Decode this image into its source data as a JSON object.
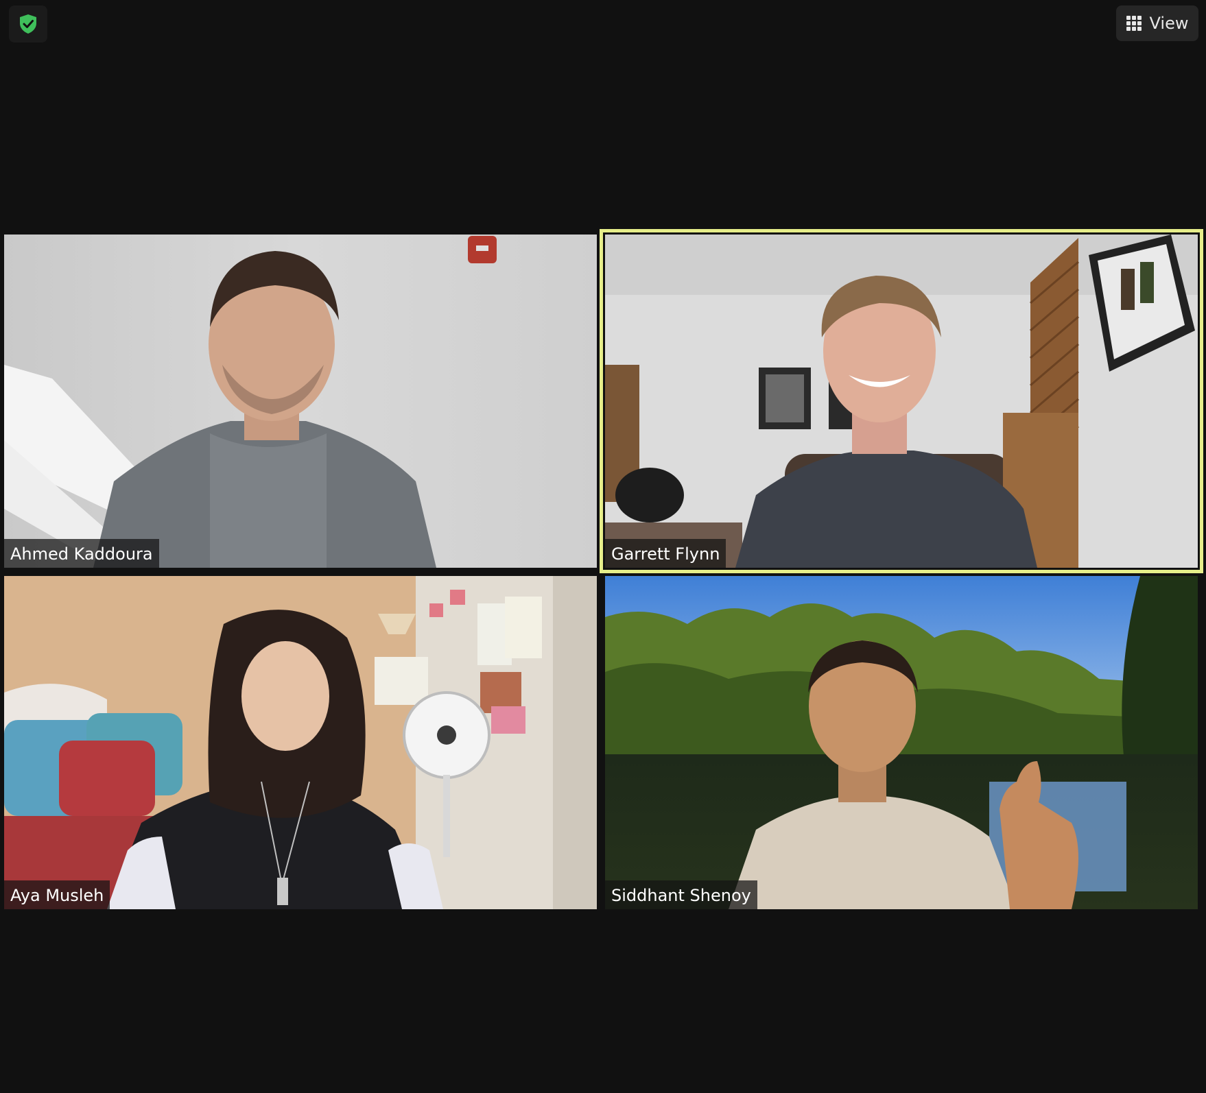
{
  "top_bar": {
    "security_icon": "shield-check-icon",
    "security_color": "#3fbf5b",
    "view_button": {
      "icon": "grid-icon",
      "label": "View"
    }
  },
  "gallery": {
    "active_speaker_color": "#e6ee8a",
    "participants": [
      {
        "name": "Ahmed Kaddoura",
        "active_speaker": false
      },
      {
        "name": "Garrett Flynn",
        "active_speaker": true
      },
      {
        "name": "Aya Musleh",
        "active_speaker": false
      },
      {
        "name": "Siddhant Shenoy",
        "active_speaker": false
      }
    ]
  }
}
